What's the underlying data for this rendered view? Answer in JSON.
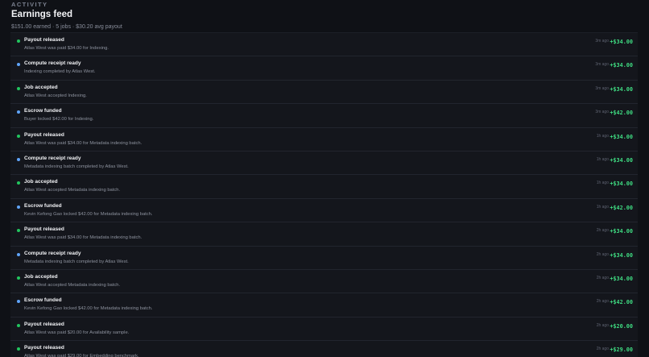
{
  "header": {
    "kicker": "ACTIVITY",
    "title": "Earnings feed",
    "subtitle": "$151.00 earned · 5 jobs · $30.20 avg payout"
  },
  "colors": {
    "success": "#22c55e",
    "info": "#60a5fa",
    "amount": "#3fdc82"
  },
  "feed": {
    "items": [
      {
        "status": "green",
        "icon": "status-dot-success",
        "title": "Payout released",
        "desc": "Atlas West was paid $34.00 for Indexing.",
        "time": "3m ago",
        "amount": "+$34.00"
      },
      {
        "status": "blue",
        "icon": "status-dot-info",
        "title": "Compute receipt ready",
        "desc": "Indexing completed by Atlas West.",
        "time": "3m ago",
        "amount": "+$34.00"
      },
      {
        "status": "green",
        "icon": "status-dot-success",
        "title": "Job accepted",
        "desc": "Atlas West accepted Indexing.",
        "time": "3m ago",
        "amount": "+$34.00"
      },
      {
        "status": "blue",
        "icon": "status-dot-info",
        "title": "Escrow funded",
        "desc": "Buyer locked $42.00 for Indexing.",
        "time": "3m ago",
        "amount": "+$42.00"
      },
      {
        "status": "green",
        "icon": "status-dot-success",
        "title": "Payout released",
        "desc": "Atlas West was paid $34.00 for Metadata indexing batch.",
        "time": "1h ago",
        "amount": "+$34.00"
      },
      {
        "status": "blue",
        "icon": "status-dot-info",
        "title": "Compute receipt ready",
        "desc": "Metadata indexing batch completed by Atlas West.",
        "time": "1h ago",
        "amount": "+$34.00"
      },
      {
        "status": "green",
        "icon": "status-dot-success",
        "title": "Job accepted",
        "desc": "Atlas West accepted Metadata indexing batch.",
        "time": "1h ago",
        "amount": "+$34.00"
      },
      {
        "status": "blue",
        "icon": "status-dot-info",
        "title": "Escrow funded",
        "desc": "Kevin Kefong Gao locked $42.00 for Metadata indexing batch.",
        "time": "1h ago",
        "amount": "+$42.00"
      },
      {
        "status": "green",
        "icon": "status-dot-success",
        "title": "Payout released",
        "desc": "Atlas West was paid $34.00 for Metadata indexing batch.",
        "time": "2h ago",
        "amount": "+$34.00"
      },
      {
        "status": "blue",
        "icon": "status-dot-info",
        "title": "Compute receipt ready",
        "desc": "Metadata indexing batch completed by Atlas West.",
        "time": "2h ago",
        "amount": "+$34.00"
      },
      {
        "status": "green",
        "icon": "status-dot-success",
        "title": "Job accepted",
        "desc": "Atlas West accepted Metadata indexing batch.",
        "time": "2h ago",
        "amount": "+$34.00"
      },
      {
        "status": "blue",
        "icon": "status-dot-info",
        "title": "Escrow funded",
        "desc": "Kevin Kefong Gao locked $42.00 for Metadata indexing batch.",
        "time": "2h ago",
        "amount": "+$42.00"
      },
      {
        "status": "green",
        "icon": "status-dot-success",
        "title": "Payout released",
        "desc": "Atlas West was paid $20.00 for Availability sample.",
        "time": "2h ago",
        "amount": "+$20.00"
      },
      {
        "status": "green",
        "icon": "status-dot-success",
        "title": "Payout released",
        "desc": "Atlas West was paid $29.00 for Embedding benchmark.",
        "time": "2h ago",
        "amount": "+$29.00"
      }
    ]
  }
}
